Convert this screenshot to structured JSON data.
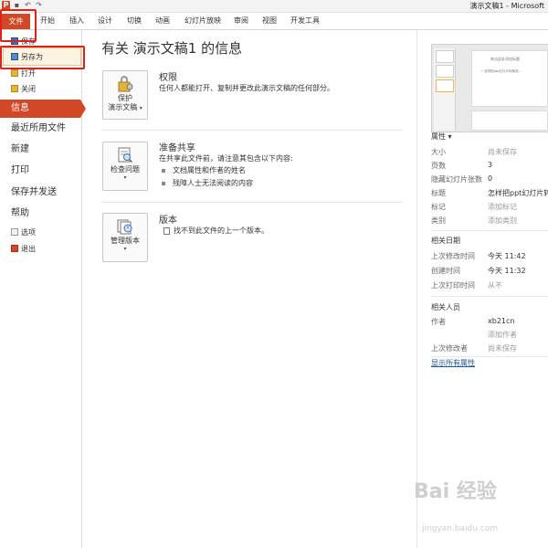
{
  "window": {
    "title": "演示文稿1 - Microsoft"
  },
  "qat": {
    "app_icon": "P",
    "save_icon": "save-icon",
    "undo_icon": "undo-icon",
    "redo_icon": "redo-icon"
  },
  "ribbon": {
    "tabs": [
      "文件",
      "开始",
      "插入",
      "设计",
      "切换",
      "动画",
      "幻灯片放映",
      "审阅",
      "视图",
      "开发工具"
    ]
  },
  "nav": {
    "small": [
      "保存",
      "另存为",
      "打开",
      "关闭"
    ],
    "big": [
      "信息",
      "最近所用文件",
      "新建",
      "打印",
      "保存并发送",
      "帮助"
    ],
    "bottom": [
      "选项",
      "退出"
    ]
  },
  "info": {
    "title": "有关 演示文稿1 的信息",
    "permissions": {
      "button_line1": "保护",
      "button_line2": "演示文稿",
      "heading": "权限",
      "text": "任何人都能打开、复制并更改此演示文稿的任何部分。"
    },
    "prepare": {
      "button": "检查问题",
      "heading": "准备共享",
      "text": "在共享此文件前，请注意其包含以下内容:",
      "bullets": [
        "文档属性和作者的姓名",
        "残障人士无法阅读的内容"
      ]
    },
    "versions": {
      "button": "管理版本",
      "heading": "版本",
      "text": "找不到此文件的上一个版本。"
    }
  },
  "preview": {
    "slide_title": "单击此处添加标题",
    "slide_text": "• 怎样把ppt幻灯片转换成..."
  },
  "properties": {
    "heading": "属性 ▾",
    "rows": [
      {
        "key": "大小",
        "value": "尚未保存"
      },
      {
        "key": "页数",
        "value": "3"
      },
      {
        "key": "隐藏幻灯片张数",
        "value": "0"
      },
      {
        "key": "标题",
        "value": "怎样把ppt幻灯片转换"
      },
      {
        "key": "标记",
        "value": "添加标记"
      },
      {
        "key": "类别",
        "value": "添加类别"
      }
    ],
    "dates_heading": "相关日期",
    "dates": [
      {
        "key": "上次修改时间",
        "value": "今天 11:42"
      },
      {
        "key": "创建时间",
        "value": "今天 11:32"
      },
      {
        "key": "上次打印时间",
        "value": "从不"
      }
    ],
    "people_heading": "相关人员",
    "author_key": "作者",
    "author_value": "xb21cn",
    "add_author": "添加作者",
    "last_modified_by_key": "上次修改者",
    "last_modified_by_value": "尚未保存",
    "show_all": "显示所有属性"
  },
  "watermark": {
    "main": "Bai 经验",
    "sub": "jingyan.baidu.com"
  }
}
